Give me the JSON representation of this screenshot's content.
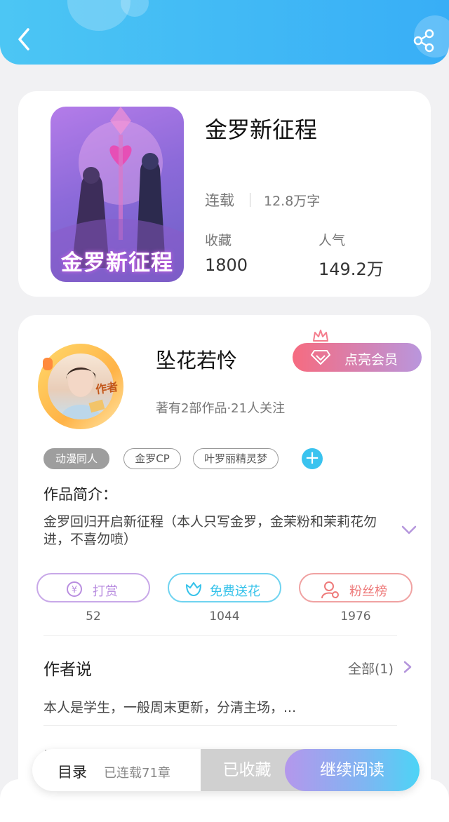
{
  "header": {
    "back_icon": "chevron-left-icon",
    "share_icon": "share-icon",
    "background_color": "#38aef6"
  },
  "book": {
    "cover_text": "金罗新征程",
    "title": "金罗新征程",
    "status": "连载",
    "word_count": "12.8万字",
    "stats": [
      {
        "label": "收藏",
        "value": "1800"
      },
      {
        "label": "人气",
        "value": "149.2万"
      }
    ]
  },
  "author": {
    "avatar_tag": "作者",
    "name": "坠花若怜",
    "meta": "著有2部作品·21人关注",
    "vip_button": "点亮会员",
    "vip_color_start": "#f66b80",
    "vip_color_end": "#b996dd"
  },
  "tags": [
    "动漫同人",
    "金罗CP",
    "叶罗丽精灵梦"
  ],
  "intro": {
    "heading": "作品简介：",
    "text": "金罗回归开启新征程（本人只写金罗，金茉粉和茉莉花勿进，不喜勿喷）"
  },
  "actions": [
    {
      "label": "打赏",
      "count": "52",
      "icon": "yen-coin-icon",
      "color": "#b98ee0"
    },
    {
      "label": "免费送花",
      "count": "1044",
      "icon": "flower-icon",
      "color": "#34c2ea"
    },
    {
      "label": "粉丝榜",
      "count": "1976",
      "icon": "fans-user-icon",
      "color": "#ee7a7a"
    }
  ],
  "author_says": {
    "heading": "作者说",
    "all_link": "全部(1)",
    "text": "本人是学生，一般周末更新，分清主场，..."
  },
  "cutoff_text": "评论",
  "bottom_bar": {
    "toc": "目录",
    "chapters": "已连载71章",
    "favorite": "已收藏",
    "continue": "继续阅读"
  }
}
